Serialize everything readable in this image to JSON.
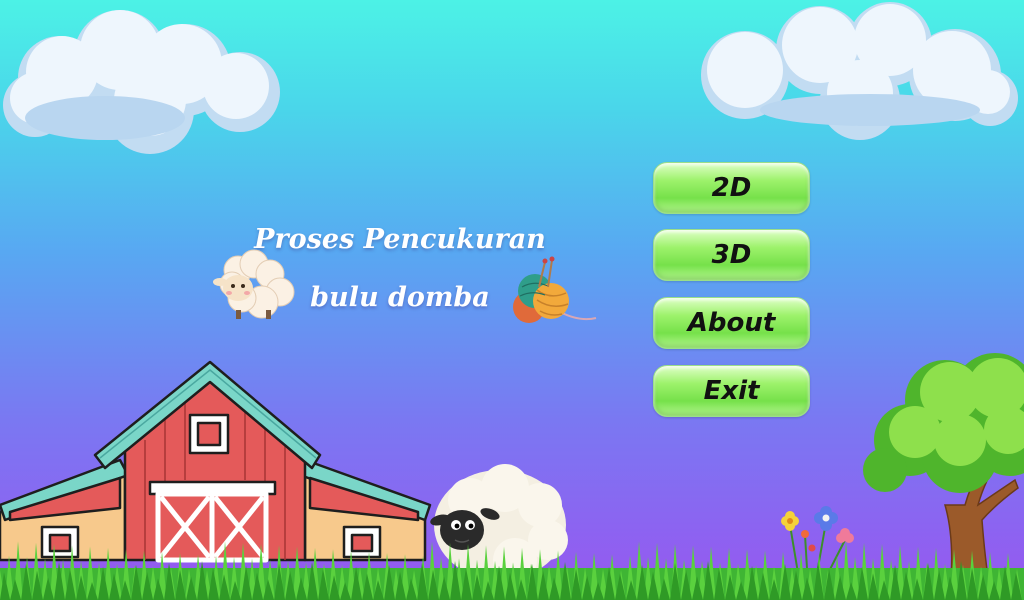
{
  "title": {
    "line1": "Proses Pencukuran",
    "line2": "bulu domba"
  },
  "menu": {
    "btn_2d": "2D",
    "btn_3d": "3D",
    "btn_about": "About",
    "btn_exit": "Exit"
  },
  "colors": {
    "sky_top": "#4cf2e6",
    "sky_bottom": "#9856f0",
    "button_green": "#76e14a",
    "barn_red": "#e45a5a",
    "barn_roof": "#7ad6c8",
    "grass": "#3fb534"
  },
  "icons": [
    "cloud-icon",
    "sheep-icon",
    "yarn-icon",
    "barn-icon",
    "tree-icon",
    "flower-icon"
  ]
}
